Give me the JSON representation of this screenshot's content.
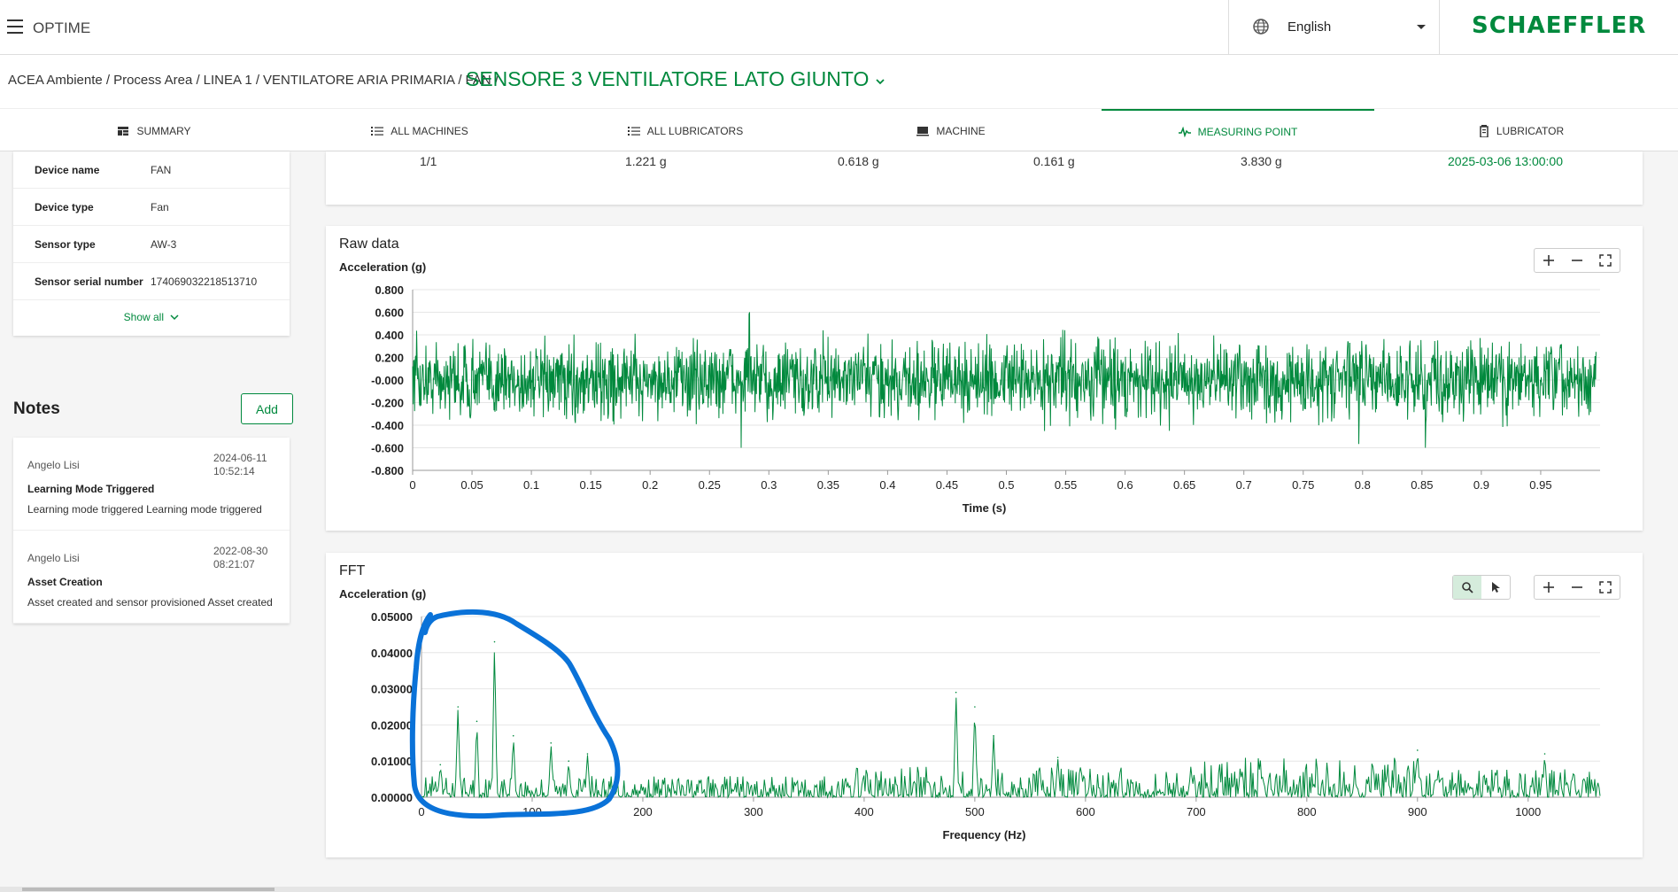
{
  "header": {
    "app_name": "OPTIME",
    "language": "English",
    "brand": "SCHAEFFLER",
    "icons": [
      "menu-icon",
      "globe-icon",
      "caret-down-icon"
    ]
  },
  "breadcrumb": {
    "items": [
      "ACEA Ambiente /",
      "Process Area /",
      "LINEA 1 /",
      "VENTILATORE ARIA PRIMARIA /",
      "FAN /"
    ],
    "current": "SENSORE 3 VENTILATORE LATO GIUNTO"
  },
  "tabs": [
    {
      "label": "SUMMARY",
      "icon": "summary-icon"
    },
    {
      "label": "ALL MACHINES",
      "icon": "list-icon"
    },
    {
      "label": "ALL LUBRICATORS",
      "icon": "list-icon"
    },
    {
      "label": "MACHINE",
      "icon": "machine-icon"
    },
    {
      "label": "MEASURING POINT",
      "icon": "pulse-icon",
      "active": true
    },
    {
      "label": "LUBRICATOR",
      "icon": "lubricator-icon"
    }
  ],
  "device_info": {
    "rows": [
      {
        "key": "Device name",
        "value": "FAN"
      },
      {
        "key": "Device type",
        "value": "Fan"
      },
      {
        "key": "Sensor type",
        "value": "AW-3"
      },
      {
        "key": "Sensor serial number",
        "value": "174069032218513710"
      }
    ],
    "show_all": "Show all"
  },
  "notes": {
    "title": "Notes",
    "add_label": "Add",
    "items": [
      {
        "author": "Angelo Lisi",
        "date": "2024-06-11",
        "time": "10:52:14",
        "title": "Learning Mode Triggered",
        "body": "Learning mode triggered Learning mode triggered"
      },
      {
        "author": "Angelo Lisi",
        "date": "2022-08-30",
        "time": "08:21:07",
        "title": "Asset Creation",
        "body": "Asset created and sensor provisioned Asset created"
      }
    ]
  },
  "measurement_row": {
    "axis": "1/1",
    "v1": "1.221 g",
    "v2": "0.618 g",
    "v3": "0.161 g",
    "v4": "3.830 g",
    "timestamp": "2025-03-06 13:00:00"
  },
  "colors": {
    "brand": "#00893d",
    "annotation": "#0a72d8"
  },
  "chart_data": [
    {
      "type": "line",
      "title": "Raw data",
      "ylabel": "Acceleration (g)",
      "xlabel": "Time (s)",
      "xlim": [
        0,
        1
      ],
      "ylim": [
        -0.8,
        0.8
      ],
      "x_ticks": [
        "0",
        "0.05",
        "0.1",
        "0.15",
        "0.2",
        "0.25",
        "0.3",
        "0.35",
        "0.4",
        "0.45",
        "0.5",
        "0.55",
        "0.6",
        "0.65",
        "0.7",
        "0.75",
        "0.8",
        "0.85",
        "0.9",
        "0.95"
      ],
      "y_ticks": [
        "0.800",
        "0.600",
        "0.400",
        "0.200",
        "-0.000",
        "-0.200",
        "-0.400",
        "-0.600",
        "-0.800"
      ],
      "series": [
        {
          "values": []
        }
      ],
      "grid": true
    },
    {
      "type": "line",
      "title": "FFT",
      "ylabel": "Acceleration (g)",
      "xlabel": "Frequency (Hz)",
      "xlim": [
        0,
        1065
      ],
      "ylim": [
        0,
        0.05
      ],
      "x_ticks": [
        "0",
        "100",
        "200",
        "300",
        "400",
        "500",
        "600",
        "700",
        "800",
        "900",
        "1000"
      ],
      "y_ticks": [
        "0.05000",
        "0.04000",
        "0.03000",
        "0.02000",
        "0.01000",
        "0.00000"
      ],
      "series": [
        {
          "values": []
        }
      ],
      "peaks": [
        {
          "x": 17,
          "y": 0.009
        },
        {
          "x": 33,
          "y": 0.025
        },
        {
          "x": 50,
          "y": 0.021
        },
        {
          "x": 66,
          "y": 0.043
        },
        {
          "x": 83,
          "y": 0.017
        },
        {
          "x": 117,
          "y": 0.015
        },
        {
          "x": 133,
          "y": 0.01
        },
        {
          "x": 150,
          "y": 0.012
        },
        {
          "x": 483,
          "y": 0.029
        },
        {
          "x": 500,
          "y": 0.025
        },
        {
          "x": 517,
          "y": 0.017
        },
        {
          "x": 575,
          "y": 0.011
        },
        {
          "x": 900,
          "y": 0.013
        },
        {
          "x": 1015,
          "y": 0.012
        }
      ],
      "grid": true
    }
  ]
}
